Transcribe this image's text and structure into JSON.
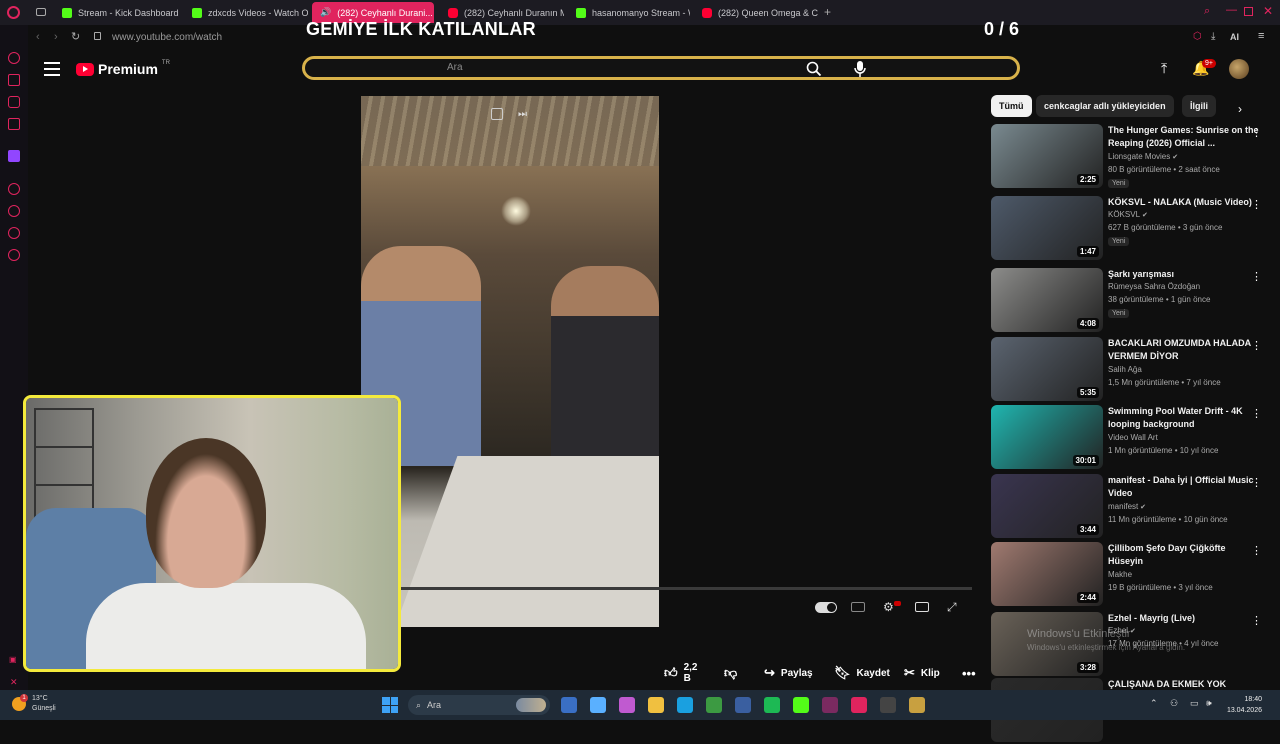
{
  "browser": {
    "tabs": [
      {
        "label": "Stream - Kick Dashboard",
        "favicon": "kick-icon",
        "active": false
      },
      {
        "label": "zdxcds Videos - Watch On...",
        "favicon": "kick-icon",
        "active": false
      },
      {
        "label": "(282) Ceyhanlı Durani...",
        "favicon": "youtube-icon",
        "active": true
      },
      {
        "label": "(282) Ceyhanlı Duranın M...",
        "favicon": "youtube-icon",
        "active": false
      },
      {
        "label": "hasanomanyo Stream - W...",
        "favicon": "kick-icon",
        "active": false
      },
      {
        "label": "(282) Queen Omega & Che...",
        "favicon": "youtube-icon",
        "active": false
      }
    ],
    "url": "www.youtube.com/watch",
    "ai_label": "AI"
  },
  "overlay": {
    "title": "GEMİYE İLK KATILANLAR",
    "count": "0 / 6"
  },
  "youtube": {
    "logo_text": "Premium",
    "logo_region": "TR",
    "search_placeholder": "Ara",
    "notification_count": "9+",
    "chips": [
      "Tümü",
      "cenkcaglar adlı yükleyiciden",
      "İlgili"
    ],
    "actions": {
      "like_count": "2,2 B",
      "share_label": "Paylaş",
      "save_label": "Kaydet",
      "clip_label": "Klip"
    },
    "recommendations": [
      {
        "title": "The Hunger Games: Sunrise on the Reaping (2026) Official ...",
        "channel": "Lionsgate Movies",
        "verified": true,
        "meta": "80 B görüntüleme • 2 saat önce",
        "badge": "Yeni",
        "duration": "2:25",
        "short": false,
        "thumb_color": "#7a8a90"
      },
      {
        "title": "KÖKSVL - NALAKA (Music Video)",
        "channel": "KÖKSVL",
        "verified": true,
        "meta": "627 B görüntüleme • 3 gün önce",
        "badge": "Yeni",
        "duration": "1:47",
        "short": true,
        "thumb_color": "#4e5a6a"
      },
      {
        "title": "Şarkı yarışması",
        "channel": "Rümeysa Sahra Özdoğan",
        "verified": false,
        "meta": "38 görüntüleme • 1 gün önce",
        "badge": "Yeni",
        "duration": "4:08",
        "short": false,
        "thumb_color": "#8c8c8a"
      },
      {
        "title": "BACAKLARI OMZUMDA HALADA VERMEM DİYOR",
        "channel": "Salih Ağa",
        "verified": false,
        "meta": "1,5 Mn görüntüleme • 7 yıl önce",
        "badge": "",
        "duration": "5:35",
        "short": false,
        "thumb_color": "#5b6470"
      },
      {
        "title": "Swimming Pool Water Drift - 4K looping background",
        "channel": "Video Wall Art",
        "verified": false,
        "meta": "1 Mn görüntüleme • 10 yıl önce",
        "badge": "",
        "duration": "30:01",
        "short": false,
        "thumb_color": "#1fb6b0"
      },
      {
        "title": "manifest - Daha İyi | Official Music Video",
        "channel": "manifest",
        "verified": true,
        "meta": "11 Mn görüntüleme • 10 gün önce",
        "badge": "",
        "duration": "3:44",
        "short": true,
        "thumb_color": "#3a3550"
      },
      {
        "title": "Çillibom Şefo Dayı Çiğköfte Hüseyin",
        "channel": "Makhe",
        "verified": false,
        "meta": "19 B görüntüleme • 3 yıl önce",
        "badge": "",
        "duration": "2:44",
        "short": false,
        "thumb_color": "#a07a70"
      },
      {
        "title": "Ezhel - Mayrig (Live)",
        "channel": "Ezhel",
        "verified": true,
        "meta": "17 Mn görüntüleme • 4 yıl önce",
        "badge": "",
        "duration": "3:28",
        "short": true,
        "thumb_color": "#6a6258"
      },
      {
        "title": "ÇALIŞANA DA EKMEK YOK",
        "channel": "",
        "verified": false,
        "meta": "",
        "badge": "",
        "duration": "",
        "short": false,
        "thumb_color": "#2a2a2a"
      }
    ]
  },
  "windows_watermark": {
    "line1": "Windows'u Etkinleştir",
    "line2": "Windows'u etkinleştirmek için Ayarlar'a gidin."
  },
  "taskbar": {
    "weather_temp": "13°C",
    "weather_desc": "Güneşli",
    "weather_notification": "1",
    "search_placeholder": "Ara",
    "time": "18:40",
    "date": "13.04.2026",
    "apps": [
      "explorer-icon",
      "store-icon",
      "copilot-icon",
      "folder-icon",
      "edge-icon",
      "chrome-icon",
      "app-icon",
      "spotify-icon",
      "kick-icon",
      "app-icon",
      "opera-icon",
      "obs-icon",
      "app-icon"
    ]
  },
  "colors": {
    "accent_pink": "#e0245e",
    "search_border": "#d8b24a",
    "webcam_border": "#f4ea3c",
    "youtube_red": "#ff0033"
  }
}
